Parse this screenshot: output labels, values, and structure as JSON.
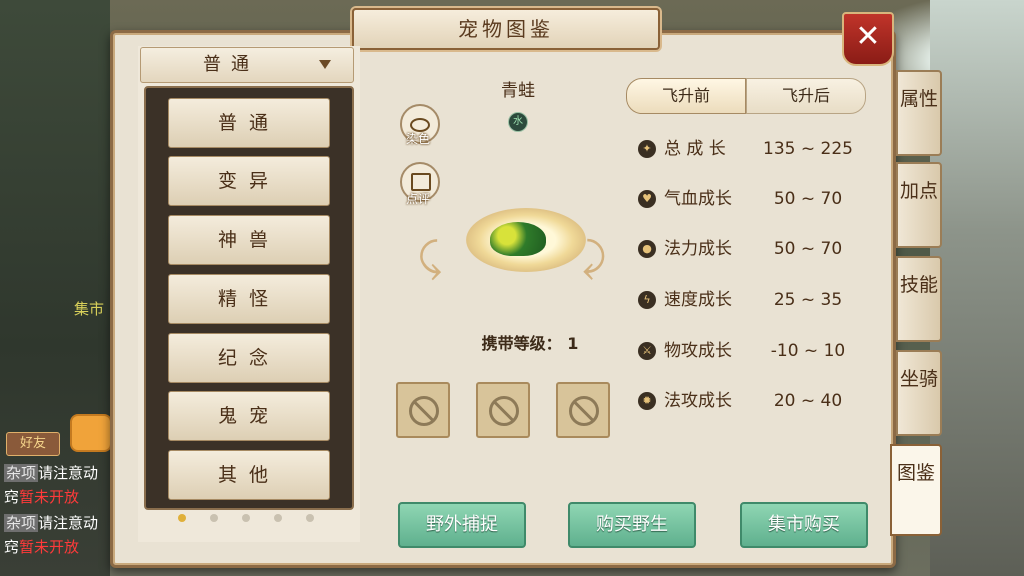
{
  "window": {
    "title": "宠物图鉴",
    "close_symbol": "✕"
  },
  "category_dropdown": {
    "selected": "普通",
    "options": [
      "普通",
      "变异",
      "神兽",
      "精怪",
      "纪念",
      "鬼宠",
      "其他"
    ]
  },
  "pet": {
    "name": "青蛙",
    "element": "水",
    "carry_level_label": "携带等级：",
    "carry_level_value": "1"
  },
  "side_buttons": {
    "dye_label": "染色",
    "comment_label": "点评"
  },
  "growth_tabs": {
    "before": "飞升前",
    "after": "飞升后",
    "active": "飞升前"
  },
  "stats": [
    {
      "name": "总 成 长",
      "range": "135 ~ 225",
      "icon": "total-growth-icon"
    },
    {
      "name": "气血成长",
      "range": "50 ~ 70",
      "icon": "hp-growth-icon"
    },
    {
      "name": "法力成长",
      "range": "50 ~ 70",
      "icon": "mana-growth-icon"
    },
    {
      "name": "速度成长",
      "range": "25 ~ 35",
      "icon": "speed-growth-icon"
    },
    {
      "name": "物攻成长",
      "range": "-10 ~ 10",
      "icon": "phys-attack-growth-icon"
    },
    {
      "name": "法攻成长",
      "range": "20 ~ 40",
      "icon": "magic-attack-growth-icon"
    }
  ],
  "actions": {
    "capture": "野外捕捉",
    "buy_wild": "购买野生",
    "market_buy": "集市购买"
  },
  "side_tabs": [
    "属性",
    "加点",
    "技能",
    "坐骑",
    "图鉴"
  ],
  "hud": {
    "friends": "好友",
    "market_hint": "集市",
    "chat": [
      {
        "tag": "杂项",
        "text": "请注意动",
        "red": ""
      },
      {
        "tag": "",
        "text": "窍",
        "red": "暂未开放"
      },
      {
        "tag": "杂项",
        "text": "请注意动",
        "red": ""
      },
      {
        "tag": "",
        "text": "窍",
        "red": "暂未开放"
      }
    ]
  },
  "colors": {
    "action_button": "#6fc29d",
    "close_button": "#b02a22",
    "frame_border": "#8c6a45"
  }
}
